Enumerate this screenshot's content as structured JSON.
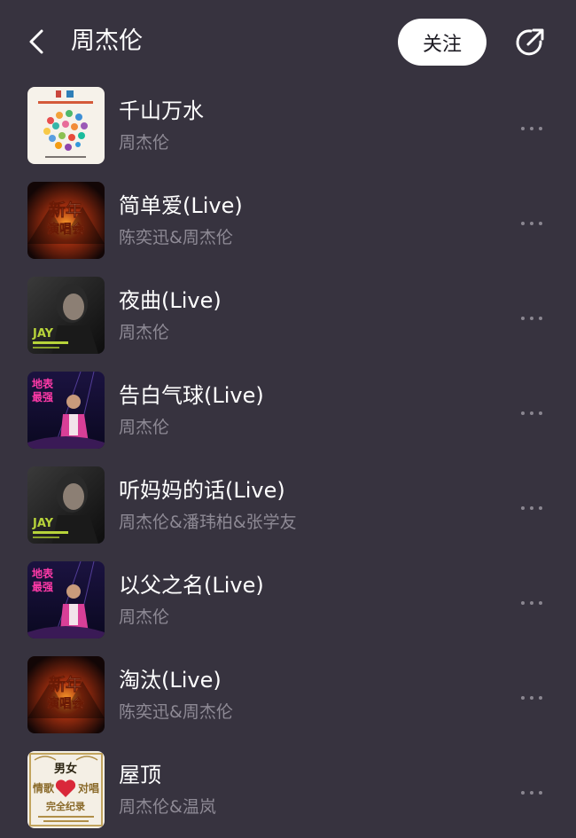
{
  "header": {
    "back_icon": "chevron-left-icon",
    "title": "周杰伦",
    "follow_label": "关注",
    "share_icon": "share-arrow-icon"
  },
  "colors": {
    "background": "#37333f",
    "primary_text": "#ffffff",
    "secondary_text": "#8e8a95",
    "follow_bg": "#ffffff"
  },
  "songs": [
    {
      "title": "千山万水",
      "artist": "周杰伦",
      "cover": "colorful-dots-cover"
    },
    {
      "title": "简单爱(Live)",
      "artist": "陈奕迅&周杰伦",
      "cover": "new-year-concert-cover"
    },
    {
      "title": "夜曲(Live)",
      "artist": "周杰伦",
      "cover": "jay-concert-cover"
    },
    {
      "title": "告白气球(Live)",
      "artist": "周杰伦",
      "cover": "earth-tour-cover"
    },
    {
      "title": "听妈妈的话(Live)",
      "artist": "周杰伦&潘玮柏&张学友",
      "cover": "jay-concert-cover"
    },
    {
      "title": "以父之名(Live)",
      "artist": "周杰伦",
      "cover": "earth-tour-cover"
    },
    {
      "title": "淘汰(Live)",
      "artist": "陈奕迅&周杰伦",
      "cover": "new-year-concert-cover"
    },
    {
      "title": "屋顶",
      "artist": "周杰伦&温岚",
      "cover": "love-songs-collection-cover"
    }
  ]
}
